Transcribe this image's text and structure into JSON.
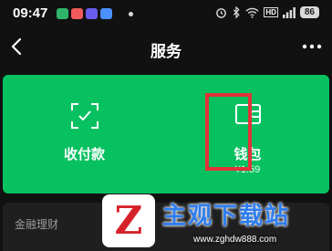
{
  "status_bar": {
    "time": "09:47",
    "app_icon_colors": [
      "#2fb56b",
      "#f05a5a",
      "#6b5cf0",
      "#4a90ff"
    ],
    "icons": [
      "alarm-icon",
      "bluetooth-icon",
      "wifi-icon",
      "hd-icon",
      "signal-icon"
    ],
    "hd_label": "HD",
    "battery": "86"
  },
  "nav": {
    "title": "服务",
    "back_icon": "chevron-left-icon",
    "more_icon": "more-icon"
  },
  "services": {
    "card_color": "#07c160",
    "tiles": [
      {
        "label": "收付款",
        "icon": "scan-icon"
      },
      {
        "label": "钱包",
        "icon": "wallet-icon",
        "sub": "¥1.59"
      }
    ],
    "highlight_color": "#e0323a"
  },
  "section": {
    "title": "金融理财"
  },
  "watermark": {
    "logo_letter": "Z",
    "title": "主观下载站",
    "url": "www.zghdw888.com"
  }
}
